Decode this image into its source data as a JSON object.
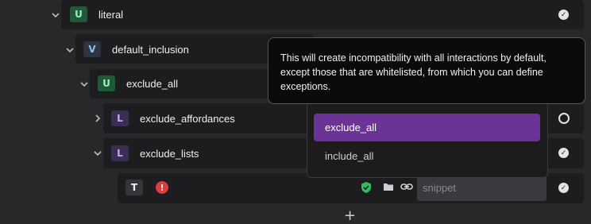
{
  "tree": {
    "literal": {
      "badge": "U",
      "label": "literal"
    },
    "default_inclusion": {
      "badge": "V",
      "label": "default_inclusion"
    },
    "exclude_all": {
      "badge": "U",
      "label": "exclude_all"
    },
    "exclude_affordances": {
      "badge": "L",
      "label": "exclude_affordances"
    },
    "exclude_lists": {
      "badge": "L",
      "label": "exclude_lists"
    },
    "snippet_row": {
      "badge": "T",
      "error_glyph": "!",
      "placeholder": "snippet"
    }
  },
  "dropdown": {
    "options": [
      {
        "label": "exclude_all",
        "selected": true
      },
      {
        "label": "include_all",
        "selected": false
      }
    ]
  },
  "tooltip": {
    "text": "This will create incompatibility with all interactions by default, except those that are whitelisted, from which you can define exceptions."
  },
  "add_glyph": "+",
  "colors": {
    "background": "#28282a",
    "row": "#1d1d1f",
    "selected_option": "#6a3395",
    "error": "#e03a3a",
    "shield": "#2fbf5f"
  }
}
